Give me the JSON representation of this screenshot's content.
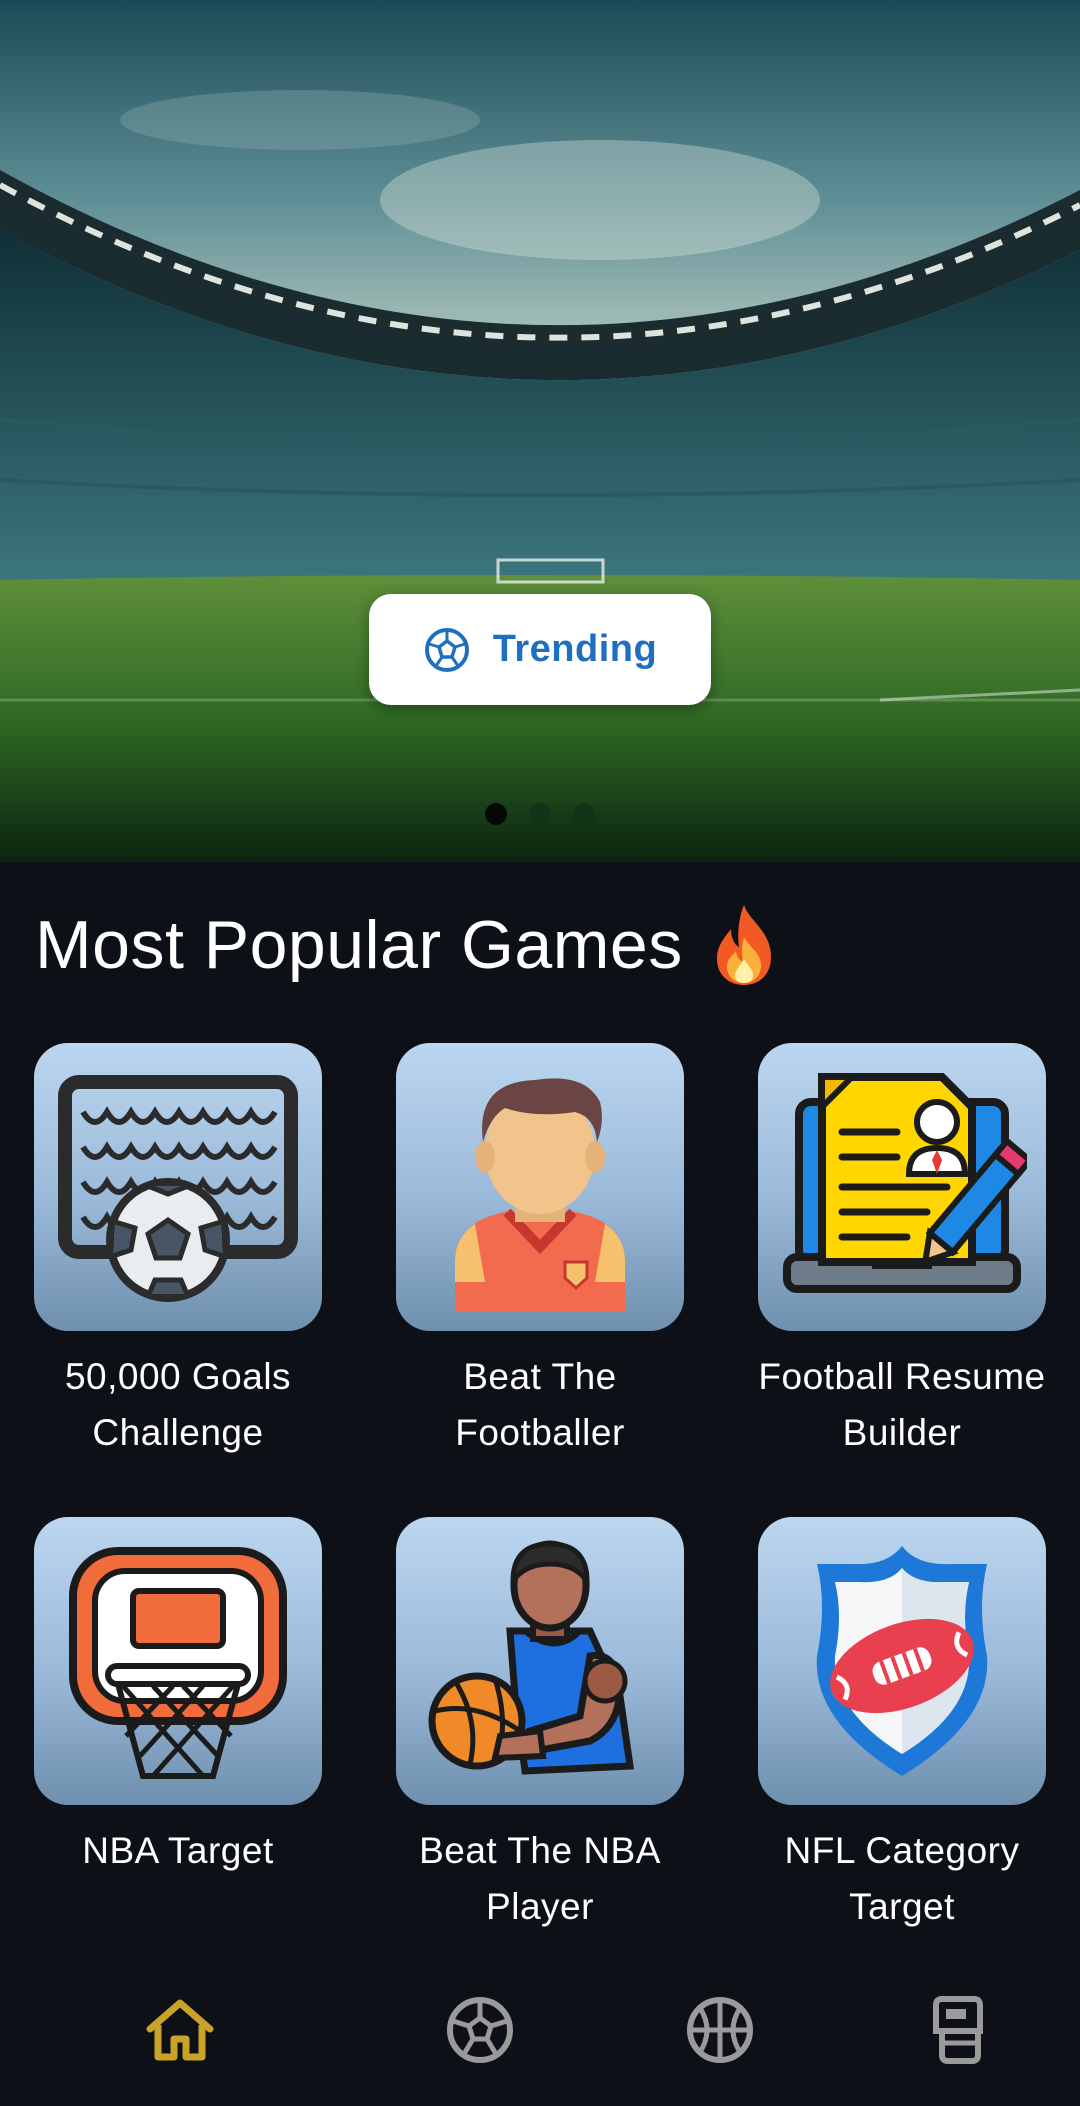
{
  "hero": {
    "trending_label": "Trending",
    "trending_icon": "soccer-ball-icon",
    "carousel_pages": 3,
    "carousel_active_index": 0
  },
  "section": {
    "title": "Most Popular Games",
    "title_icon": "fire-icon"
  },
  "games": [
    {
      "label": "50,000 Goals Challenge",
      "icon": "goal-net-ball-icon"
    },
    {
      "label": "Beat The Footballer",
      "icon": "footballer-icon"
    },
    {
      "label": "Football Resume Builder",
      "icon": "resume-laptop-icon"
    },
    {
      "label": "NBA Target",
      "icon": "basketball-hoop-icon"
    },
    {
      "label": "Beat The NBA Player",
      "icon": "basketball-player-icon"
    },
    {
      "label": "NFL Category Target",
      "icon": "nfl-shield-icon"
    }
  ],
  "bottom_nav": {
    "items": [
      {
        "name": "home",
        "icon": "home-icon",
        "active": true
      },
      {
        "name": "football",
        "icon": "soccer-ball-icon",
        "active": false
      },
      {
        "name": "basketball",
        "icon": "basketball-icon",
        "active": false
      },
      {
        "name": "american-football",
        "icon": "football-helmet-icon",
        "active": false
      }
    ]
  },
  "colors": {
    "background": "#0d1117",
    "accent_active": "#c9a227",
    "nav_inactive": "#9a9a9a",
    "trending_text": "#1f6fbf"
  }
}
